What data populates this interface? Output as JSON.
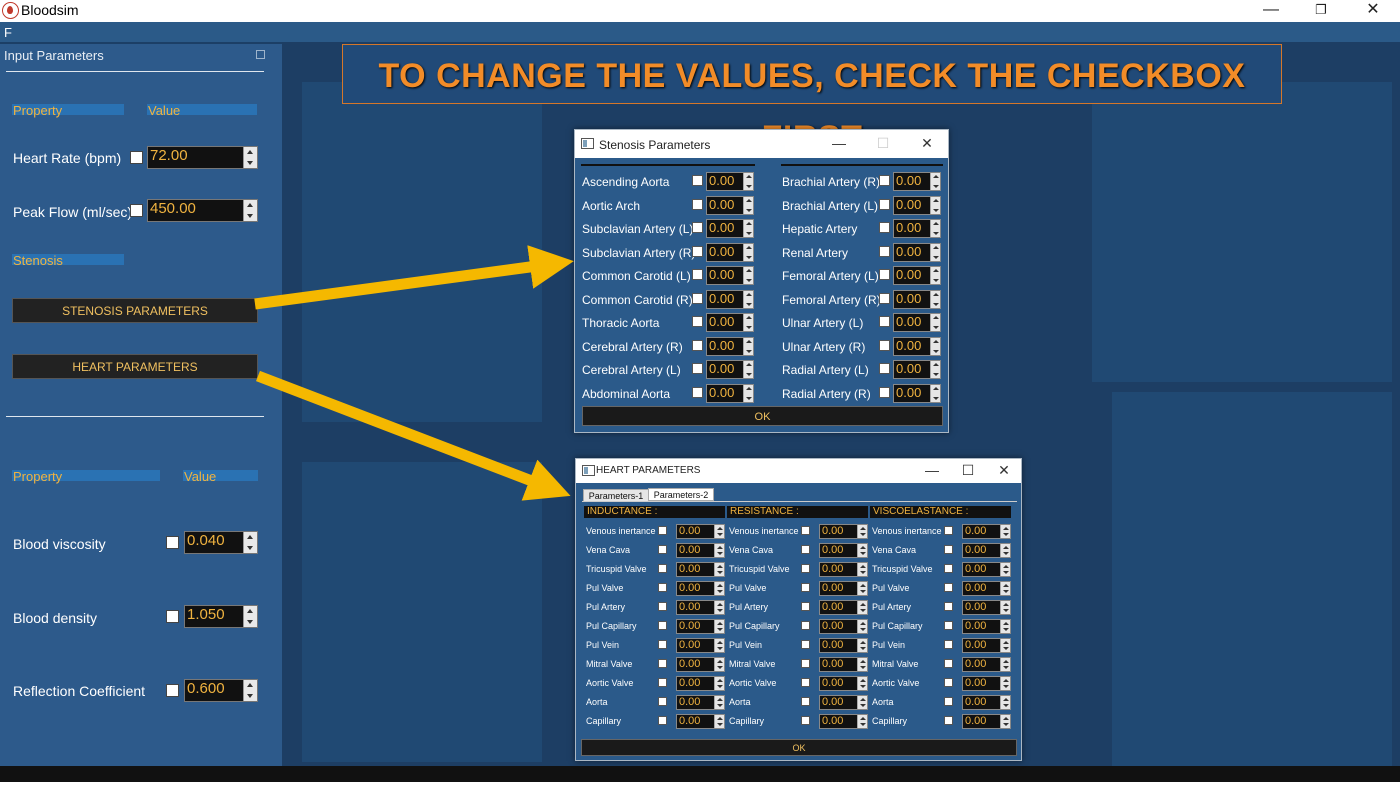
{
  "window": {
    "title": "Bloodsim",
    "minimize": "—",
    "restore": "❐",
    "close": "✕"
  },
  "menubar": {
    "label": "F"
  },
  "banner": {
    "text": "TO CHANGE THE VALUES, CHECK THE CHECKBOX FIRST"
  },
  "input_panel": {
    "title": "Input Parameters",
    "col_property": "Property",
    "col_value": "Value",
    "heart_rate": {
      "label": "Heart Rate (bpm)",
      "value": "72.00"
    },
    "peak_flow": {
      "label": "Peak Flow (ml/sec)",
      "value": "450.00"
    },
    "stenosis_header": "Stenosis",
    "stenosis_button": "STENOSIS PARAMETERS",
    "heart_button": "HEART PARAMETERS",
    "col_property2": "Property",
    "col_value2": "Value",
    "blood_viscosity": {
      "label": "Blood viscosity",
      "value": "0.040"
    },
    "blood_density": {
      "label": "Blood density",
      "value": "1.050"
    },
    "reflection": {
      "label": "Reflection Coefficient",
      "value": "0.600"
    }
  },
  "stenosis_dialog": {
    "title": "Stenosis Parameters",
    "ok": "OK",
    "left": [
      {
        "label": "Ascending Aorta",
        "value": "0.00"
      },
      {
        "label": "Aortic Arch",
        "value": "0.00"
      },
      {
        "label": "Subclavian Artery (L)",
        "value": "0.00"
      },
      {
        "label": "Subclavian Artery (R)",
        "value": "0.00"
      },
      {
        "label": "Common Carotid (L)",
        "value": "0.00"
      },
      {
        "label": "Common Carotid (R)",
        "value": "0.00"
      },
      {
        "label": "Thoracic Aorta",
        "value": "0.00"
      },
      {
        "label": "Cerebral Artery (R)",
        "value": "0.00"
      },
      {
        "label": "Cerebral Artery (L)",
        "value": "0.00"
      },
      {
        "label": "Abdominal Aorta",
        "value": "0.00"
      }
    ],
    "right": [
      {
        "label": "Brachial Artery (R)",
        "value": "0.00"
      },
      {
        "label": "Brachial Artery (L)",
        "value": "0.00"
      },
      {
        "label": "Hepatic Artery",
        "value": "0.00"
      },
      {
        "label": "Renal Artery",
        "value": "0.00"
      },
      {
        "label": "Femoral Artery (L)",
        "value": "0.00"
      },
      {
        "label": "Femoral Artery (R)",
        "value": "0.00"
      },
      {
        "label": "Ulnar Artery (L)",
        "value": "0.00"
      },
      {
        "label": "Ulnar Artery (R)",
        "value": "0.00"
      },
      {
        "label": "Radial Artery (L)",
        "value": "0.00"
      },
      {
        "label": "Radial Artery (R)",
        "value": "0.00"
      }
    ]
  },
  "heart_dialog": {
    "title": "HEART PARAMETERS",
    "tabs": [
      "Parameters-1",
      "Parameters-2"
    ],
    "ok": "OK",
    "sections": [
      {
        "title": "INDUCTANCE :",
        "rows": [
          {
            "label": "Venous inertance",
            "value": "0.00"
          },
          {
            "label": "Vena Cava",
            "value": "0.00"
          },
          {
            "label": "Tricuspid Valve",
            "value": "0.00"
          },
          {
            "label": "Pul Valve",
            "value": "0.00"
          },
          {
            "label": "Pul Artery",
            "value": "0.00"
          },
          {
            "label": "Pul Capillary",
            "value": "0.00"
          },
          {
            "label": "Pul Vein",
            "value": "0.00"
          },
          {
            "label": "Mitral Valve",
            "value": "0.00"
          },
          {
            "label": "Aortic Valve",
            "value": "0.00"
          },
          {
            "label": "Aorta",
            "value": "0.00"
          },
          {
            "label": "Capillary",
            "value": "0.00"
          }
        ]
      },
      {
        "title": "RESISTANCE :",
        "rows": [
          {
            "label": "Venous inertance",
            "value": "0.00"
          },
          {
            "label": "Vena Cava",
            "value": "0.00"
          },
          {
            "label": "Tricuspid Valve",
            "value": "0.00"
          },
          {
            "label": "Pul Valve",
            "value": "0.00"
          },
          {
            "label": "Pul Artery",
            "value": "0.00"
          },
          {
            "label": "Pul Capillary",
            "value": "0.00"
          },
          {
            "label": "Pul Vein",
            "value": "0.00"
          },
          {
            "label": "Mitral Valve",
            "value": "0.00"
          },
          {
            "label": "Aortic Valve",
            "value": "0.00"
          },
          {
            "label": "Aorta",
            "value": "0.00"
          },
          {
            "label": "Capillary",
            "value": "0.00"
          }
        ]
      },
      {
        "title": "VISCOELASTANCE :",
        "rows": [
          {
            "label": "Venous inertance",
            "value": "0.00"
          },
          {
            "label": "Vena Cava",
            "value": "0.00"
          },
          {
            "label": "Tricuspid Valve",
            "value": "0.00"
          },
          {
            "label": "Pul Valve",
            "value": "0.00"
          },
          {
            "label": "Pul Artery",
            "value": "0.00"
          },
          {
            "label": "Pul Capillary",
            "value": "0.00"
          },
          {
            "label": "Pul Vein",
            "value": "0.00"
          },
          {
            "label": "Mitral Valve",
            "value": "0.00"
          },
          {
            "label": "Aortic Valve",
            "value": "0.00"
          },
          {
            "label": "Aorta",
            "value": "0.00"
          },
          {
            "label": "Capillary",
            "value": "0.00"
          }
        ]
      }
    ]
  },
  "colors": {
    "accent": "#f0b340",
    "arrow": "#f5b800",
    "panel": "#2d5a8b",
    "banner_text": "#f28c28"
  }
}
